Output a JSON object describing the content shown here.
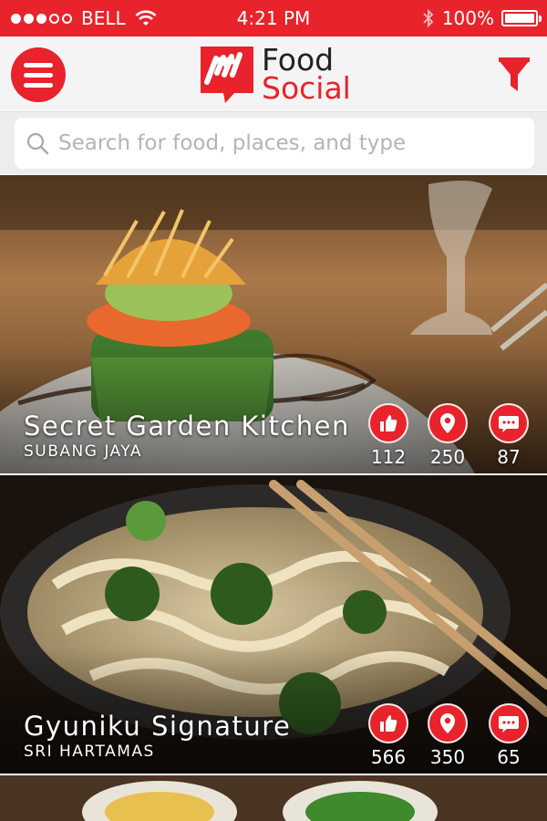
{
  "status_bar": {
    "carrier": "BELL",
    "time": "4:21 PM",
    "battery": "100%"
  },
  "header": {
    "logo_line1": "Food",
    "logo_line2": "Social",
    "brand_color": "#e8232b"
  },
  "search": {
    "placeholder": "Search for food, places, and type",
    "value": ""
  },
  "cards": [
    {
      "name": "Secret Garden Kitchen",
      "location": "SUBANG JAYA",
      "likes": "112",
      "places": "250",
      "comments": "87"
    },
    {
      "name": "Gyuniku Signature",
      "location": "SRI HARTAMAS",
      "likes": "566",
      "places": "350",
      "comments": "65"
    }
  ],
  "icons": [
    "menu-icon",
    "filter-icon",
    "search-icon",
    "thumbs-up-icon",
    "location-pin-icon",
    "chat-icon",
    "wifi-icon",
    "bluetooth-icon",
    "battery-icon"
  ]
}
